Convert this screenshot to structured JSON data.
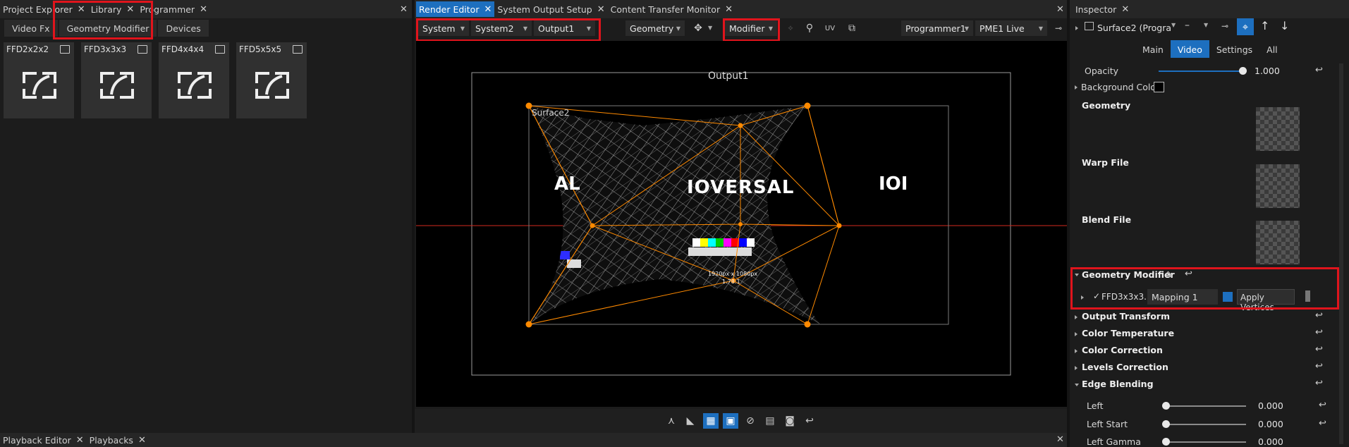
{
  "left_panel": {
    "tabs": [
      {
        "label": "Project Explorer"
      },
      {
        "label": "Library"
      },
      {
        "label": "Programmer"
      }
    ],
    "sub_tabs": [
      "Video Fx",
      "Geometry Modifier",
      "Devices"
    ],
    "cards": [
      "FFD2x2x2",
      "FFD3x3x3",
      "FFD4x4x4",
      "FFD5x5x5"
    ]
  },
  "center_panel": {
    "tabs": [
      {
        "label": "Render Editor"
      },
      {
        "label": "System Output Setup"
      },
      {
        "label": "Content Transfer Monitor"
      }
    ],
    "toolbar": {
      "system": "System",
      "system2": "System2",
      "output": "Output1",
      "geometry": "Geometry",
      "modifier": "Modifier",
      "programmer": "Programmer1",
      "live": "PME1 Live"
    },
    "canvas": {
      "output_label": "Output1",
      "surface_label": "Surface2",
      "logo_text": "IOVERSAL",
      "logo_left": "AL",
      "logo_right": "IOI",
      "resolution": "1920px x 1080px",
      "ratio": "1.78:1"
    }
  },
  "inspector": {
    "tab": "Inspector",
    "surface": "Surface2 (Progra",
    "sub_tabs": [
      "Main",
      "Video",
      "Settings",
      "All"
    ],
    "opacity_label": "Opacity",
    "opacity_value": "1.000",
    "opacity_level": 1.0,
    "background_color_label": "Background Color",
    "geometry_label": "Geometry",
    "warp_label": "Warp File",
    "blend_label": "Blend File",
    "geometry_modifier_label": "Geometry Modifier",
    "modifier_row": {
      "name": "FFD3x3x3...",
      "mapping": "Mapping 1",
      "apply": "Apply Vertices"
    },
    "sections": [
      "Output Transform",
      "Color Temperature",
      "Color Correction",
      "Levels Correction",
      "Edge Blending"
    ],
    "edge_rows": [
      {
        "label": "Left",
        "value": "0.000"
      },
      {
        "label": "Left Start",
        "value": "0.000"
      },
      {
        "label": "Left Gamma",
        "value": "0.000"
      }
    ]
  },
  "bottom_panel": {
    "tabs": [
      {
        "label": "Playback Editor"
      },
      {
        "label": "Playbacks"
      }
    ]
  },
  "colors": {
    "accent": "#1d6fbf",
    "highlight_box": "#e0141c",
    "warp_handles": "#ff8a00"
  }
}
